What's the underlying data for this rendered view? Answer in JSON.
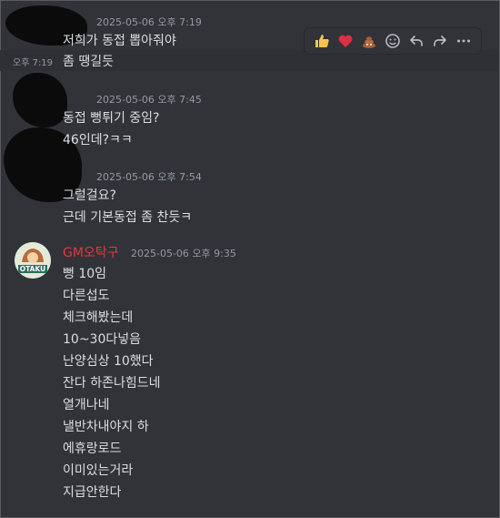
{
  "messages_top": {
    "group1": {
      "timestamp": "2025-05-06 오후 7:19",
      "lines": [
        "저희가 동접 뽑아줘야",
        "좀 땡길듯"
      ],
      "side_time": "오후 7:19"
    },
    "group2": {
      "timestamp": "2025-05-06 오후 7:45",
      "lines": [
        "동접 뻥튀기 중임?",
        "46인데?ㅋㅋ"
      ]
    },
    "group3": {
      "timestamp": "2025-05-06 오후 7:54",
      "lines": [
        "그럴걸요?",
        "근데 기본동접 좀 찬듯ㅋ"
      ]
    }
  },
  "gm_message": {
    "author": "GM오탁구",
    "timestamp": "2025-05-06 오후 9:35",
    "avatar_text": "OTAKU",
    "lines": [
      "뻥 10임",
      "다른섭도",
      "체크해봤는데",
      "10~30다넣음",
      "난양심상 10했다",
      "잔다 하존나힘드네",
      "열개나네",
      "낼반차내야지 하",
      "에휴랑로드",
      "이미있는거라",
      "지급안한다"
    ]
  },
  "toolbar": {
    "icons": [
      "thumbs-up",
      "heart",
      "poop",
      "add-reaction",
      "reply",
      "forward",
      "more"
    ],
    "colors": {
      "like": "#f6c54a",
      "heart": "#dd2e44",
      "poop": "#a5603a"
    }
  }
}
